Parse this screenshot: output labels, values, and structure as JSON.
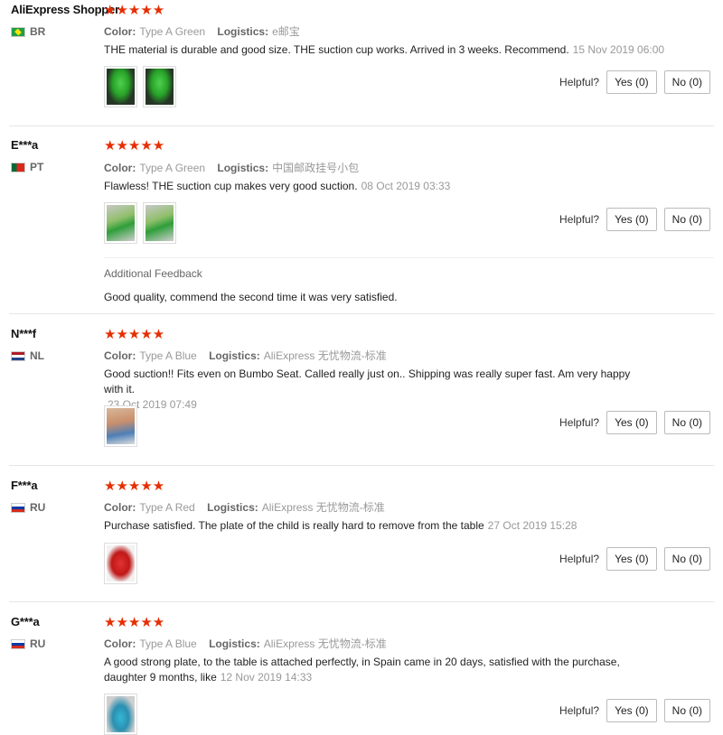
{
  "labels": {
    "color": "Color:",
    "logistics": "Logistics:",
    "helpful": "Helpful?",
    "yes": "Yes (0)",
    "no": "No (0)",
    "stars": "★★★★★",
    "additional_feedback": "Additional Feedback"
  },
  "reviews": [
    {
      "user": "AliExpress Shopper",
      "country": "BR",
      "flag_colors": [
        "#229e45",
        "#f8e509"
      ],
      "rating": 5,
      "color": "Type A Green",
      "logistics": "e邮宝",
      "text": "THE material is durable and good size. THE suction cup works. Arrived in 3 weeks. Recommend.",
      "date": "15 Nov 2019 06:00",
      "images": [
        "green-plate-photo",
        "green-plate-photo"
      ]
    },
    {
      "user": "E***a",
      "country": "PT",
      "flag_colors": [
        "#046a38",
        "#da291c"
      ],
      "rating": 5,
      "color": "Type A Green",
      "logistics": "中国邮政挂号小包",
      "text": "Flawless! THE suction cup makes very good suction.",
      "date": "08 Oct 2019 03:33",
      "images": [
        "plate-on-table-photo",
        "plate-on-table-photo"
      ],
      "additional_feedback": "Good quality, commend the second time it was very satisfied."
    },
    {
      "user": "N***f",
      "country": "NL",
      "flag_colors": [
        "#ae1c28",
        "#ffffff",
        "#21468b"
      ],
      "rating": 5,
      "color": "Type A Blue",
      "logistics": "AliExpress 无忧物流-标准",
      "text": "Good suction!! Fits even on Bumbo Seat. Called really just on.. Shipping was really super fast. Am very happy with it.",
      "date": "23 Oct 2019 07:49",
      "images": [
        "baby-seat-photo"
      ]
    },
    {
      "user": "F***a",
      "country": "RU",
      "flag_colors": [
        "#ffffff",
        "#0039a6",
        "#d52b1e"
      ],
      "rating": 5,
      "color": "Type A Red",
      "logistics": "AliExpress 无忧物流-标准",
      "text": "Purchase satisfied. The plate of the child is really hard to remove from the table",
      "date": "27 Oct 2019 15:28",
      "images": [
        "red-plate-photo"
      ]
    },
    {
      "user": "G***a",
      "country": "RU",
      "flag_colors": [
        "#ffffff",
        "#0039a6",
        "#d52b1e"
      ],
      "rating": 5,
      "color": "Type A Blue",
      "logistics": "AliExpress 无忧物流-标准",
      "text": "A good strong plate, to the table is attached perfectly, in Spain came in 20 days, satisfied with the purchase, daughter 9 months, like",
      "date": "12 Nov 2019 14:33",
      "images": [
        "blue-plate-photo"
      ]
    }
  ]
}
